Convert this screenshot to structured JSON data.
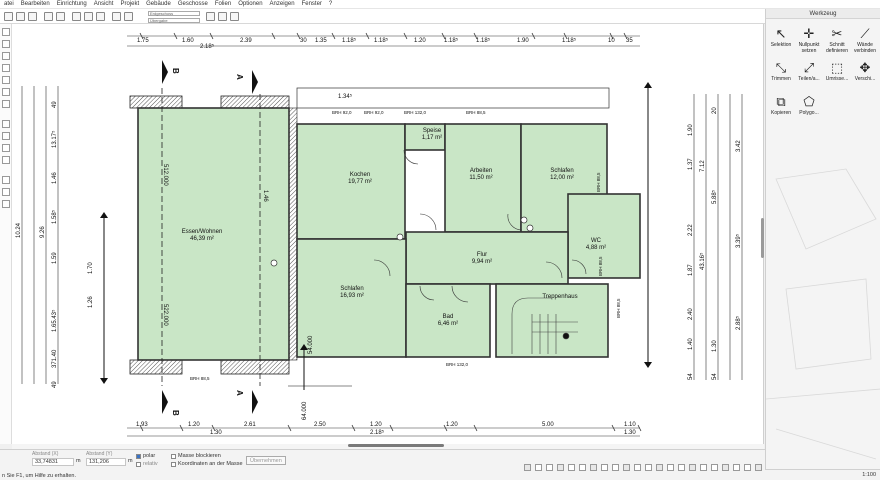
{
  "menu": [
    "atei",
    "Bearbeiten",
    "Einrichtung",
    "Ansicht",
    "Projekt",
    "Gebäude",
    "Geschosse",
    "Folien",
    "Optionen",
    "Anzeigen",
    "Fenster",
    "?"
  ],
  "toolbar": {
    "layer_label": "Erdgeschoss",
    "layer_sub": "Übergabe"
  },
  "panel": {
    "title": "Werkzeug",
    "tools": [
      {
        "label": "Selektion",
        "icon": "cursor-arrow-icon",
        "glyph": "↖"
      },
      {
        "label": "Nullpunkt setzen",
        "icon": "origin-icon",
        "glyph": "✛"
      },
      {
        "label": "Schnitt definieren",
        "icon": "section-cut-icon",
        "glyph": "✂"
      },
      {
        "label": "Wände verbinden",
        "icon": "walls-join-icon",
        "glyph": "⟋"
      },
      {
        "label": "Trimmen",
        "icon": "trim-icon",
        "glyph": "⤡"
      },
      {
        "label": "Teilen/a...",
        "icon": "split-icon",
        "glyph": "⤢"
      },
      {
        "label": "Umrisse...",
        "icon": "outline-icon",
        "glyph": "⬚"
      },
      {
        "label": "Verschi...",
        "icon": "move-icon",
        "glyph": "✥"
      },
      {
        "label": "Kopieren",
        "icon": "copy-icon",
        "glyph": "⧉"
      },
      {
        "label": "Polygo...",
        "icon": "polygon-icon",
        "glyph": "⬠"
      }
    ]
  },
  "rooms": [
    {
      "name": "Essen/Wohnen",
      "area": "46,39 m²"
    },
    {
      "name": "Kochen",
      "area": "19,77 m²"
    },
    {
      "name": "Speise",
      "area": "1,17 m²"
    },
    {
      "name": "Arbeiten",
      "area": "11,50 m²"
    },
    {
      "name": "Schlafen",
      "area": "12,00 m²"
    },
    {
      "name": "WC",
      "area": "4,88 m²"
    },
    {
      "name": "Flur",
      "area": "9,94 m²"
    },
    {
      "name": "Schlafen",
      "area": "16,93 m²"
    },
    {
      "name": "Bad",
      "area": "6,46 m²"
    },
    {
      "name": "Treppenhaus",
      "area": ""
    }
  ],
  "dims_top": [
    "1.75",
    "1.60",
    "2.18⁵",
    "2.39",
    "30",
    "1.35",
    "1.18⁵",
    "1.18⁵",
    "1.20",
    "1.18⁵",
    "1.18⁵",
    "1.90",
    "1.18⁵",
    "10",
    "35"
  ],
  "dims_bottom": [
    "1.93",
    "1.20",
    "1.30",
    "2.61",
    "2.50",
    "1.20",
    "2.18⁵",
    "1.20",
    "5.00",
    "1.10",
    "1.30"
  ],
  "dims_left": [
    "10.24",
    "9.26",
    "49",
    "13.17⁵",
    "1.46",
    "1.58⁵",
    "1.59",
    "1.70",
    "1.26",
    "1.65.43⁵",
    "371.40",
    "49"
  ],
  "dims_right": [
    "3.42",
    "3.39⁵",
    "2.88⁵",
    "1.90",
    "1.37",
    "5.88⁵",
    "2.22",
    "7.12",
    "43.16⁵",
    "1.87",
    "2.40",
    "1.40",
    "1.30",
    "54",
    "20",
    "54"
  ],
  "brh": [
    "BRH 92,0",
    "BRH 92,0",
    "BRH 132,0",
    "BRH 88,5",
    "BRH 88,5",
    "BRH 132,0",
    "BRH 88,5",
    "BRH 88,5",
    "BRH 88,5"
  ],
  "sections": {
    "b": "B",
    "a": "A"
  },
  "misc": {
    "top_mark": "1.34⁵",
    "dim_512": "512.000",
    "dim_522": "522.000",
    "dim_54": "54.000",
    "dim_64": "64.000",
    "dim_146": "1.46"
  },
  "status": {
    "label_x": "Abstand (X)",
    "value_x": "33,74831",
    "unit_x": "m",
    "label_y": "Abstand (Y)",
    "value_y": "131,206",
    "unit_y": "m",
    "polar": "polar",
    "relativ": "relativ",
    "mass_block": "Masse blockieren",
    "koord": "Koordinaten an der Masse",
    "apply_btn": "Übernehmen",
    "hint": "n Sie F1, um Hilfe zu erhalten.",
    "scale": "1:100"
  }
}
